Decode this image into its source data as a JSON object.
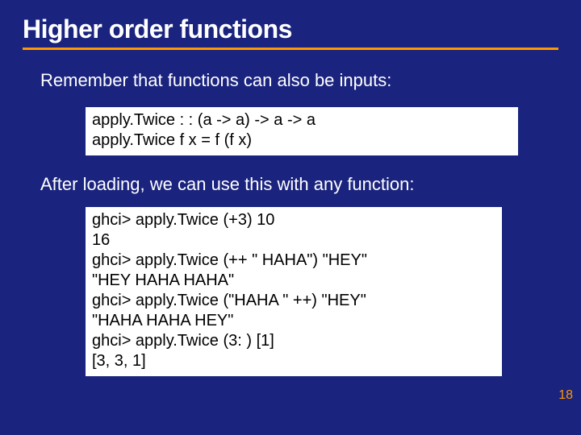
{
  "title": "Higher order functions",
  "intro": "Remember that functions can also be inputs:",
  "code1": "apply.Twice : : (a -> a) -> a -> a\napply.Twice f x = f (f x)",
  "mid": "After loading, we can use this with any function:",
  "code2": "ghci> apply.Twice (+3) 10\n16\nghci> apply.Twice (++ \" HAHA\") \"HEY\"\n\"HEY HAHA HAHA\"\nghci> apply.Twice (\"HAHA \" ++) \"HEY\"\n\"HAHA HAHA HEY\"\nghci> apply.Twice (3: ) [1]\n[3, 3, 1]",
  "page": "18"
}
